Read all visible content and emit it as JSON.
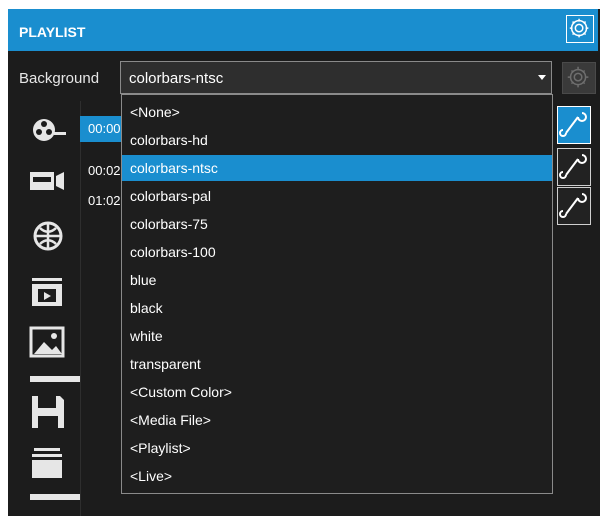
{
  "header": {
    "title": "PLAYLIST",
    "settings_icon": "gear-icon",
    "accent_color": "#1a8ecf"
  },
  "background": {
    "label": "Background",
    "selected": "colorbars-ntsc",
    "options": [
      "<None>",
      "colorbars-hd",
      "colorbars-ntsc",
      "colorbars-pal",
      "colorbars-75",
      "colorbars-100",
      "blue",
      "black",
      "white",
      "transparent",
      "<Custom Color>",
      "<Media File>",
      "<Playlist>",
      "<Live>"
    ],
    "gear_icon": "gear-icon"
  },
  "sidebar": {
    "icons": [
      "film-reel-icon",
      "camera-icon",
      "globe-icon",
      "folder-media-icon",
      "image-icon",
      "save-icon",
      "open-folder-icon"
    ]
  },
  "playlist": {
    "rows": [
      {
        "time": "00:00",
        "selected": true
      },
      {
        "time": "00:02",
        "selected": false
      },
      {
        "time": "01:02",
        "selected": false
      }
    ],
    "row_icon": "wrench-icon"
  }
}
